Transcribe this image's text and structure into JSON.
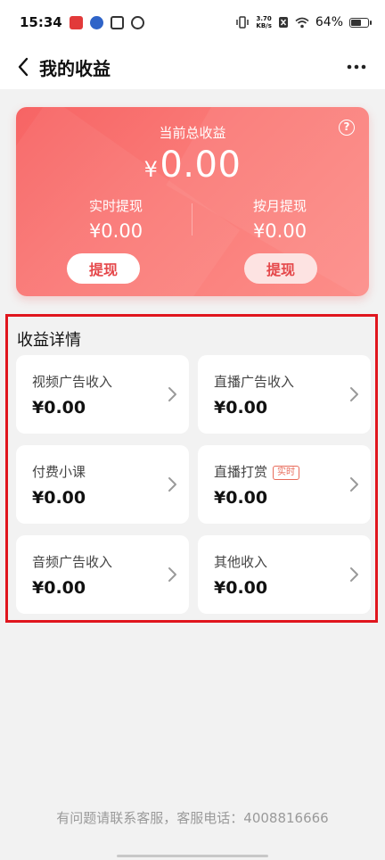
{
  "status_bar": {
    "time": "15:34",
    "net_speed_value": "3.70",
    "net_speed_unit": "KB/s",
    "battery": "64%"
  },
  "header": {
    "title": "我的收益"
  },
  "summary": {
    "total_label": "当前总收益",
    "total_currency": "¥",
    "total_value": "0.00",
    "realtime_label": "实时提现",
    "realtime_value": "¥0.00",
    "monthly_label": "按月提现",
    "monthly_value": "¥0.00",
    "withdraw_label": "提现",
    "help": "?"
  },
  "details": {
    "title": "收益详情",
    "items": [
      {
        "label": "视频广告收入",
        "value": "¥0.00"
      },
      {
        "label": "直播广告收入",
        "value": "¥0.00"
      },
      {
        "label": "付费小课",
        "value": "¥0.00"
      },
      {
        "label": "直播打赏",
        "value": "¥0.00",
        "tag": "实时"
      },
      {
        "label": "音频广告收入",
        "value": "¥0.00"
      },
      {
        "label": "其他收入",
        "value": "¥0.00"
      }
    ]
  },
  "footer": {
    "text": "有问题请联系客服，客服电话：4008816666"
  },
  "colors": {
    "accent": "#e5474a",
    "card_gradient_start": "#f76464",
    "card_gradient_end": "#fc8e89",
    "highlight_border": "#e0161e"
  }
}
